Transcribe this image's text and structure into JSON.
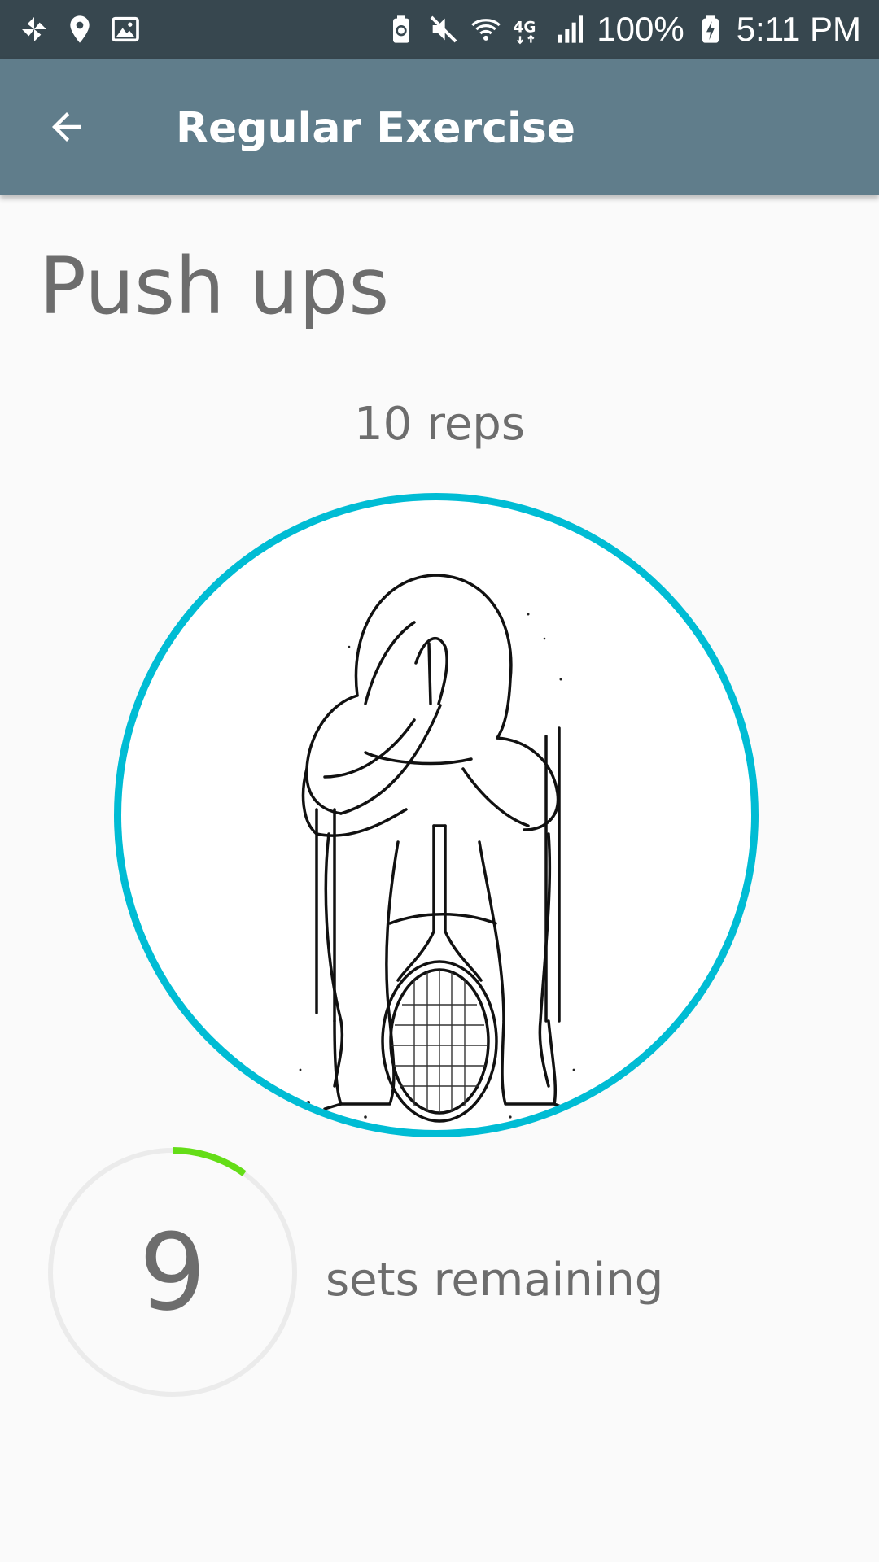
{
  "status_bar": {
    "battery_percent": "100%",
    "time": "5:11 PM",
    "left_icons": [
      "pinwheel-icon",
      "location-pin-icon",
      "image-icon"
    ],
    "right_icons": [
      "recycle-battery-icon",
      "mute-icon",
      "wifi-icon",
      "lte-4g-icon",
      "signal-icon",
      "charging-battery-icon"
    ]
  },
  "app_bar": {
    "back_icon": "arrow-left-icon",
    "title": "Regular Exercise"
  },
  "exercise": {
    "name": "Push ups",
    "reps": "10 reps",
    "illustration": "seated-player-with-tennis-racket-sketch"
  },
  "sets": {
    "remaining": "9",
    "label": "sets remaining",
    "progress_fraction": 0.1
  },
  "colors": {
    "status_bar": "#37474f",
    "app_bar": "#607d8b",
    "accent_ring": "#00bcd4",
    "progress": "#64dd17",
    "text": "#6d6d6d"
  }
}
